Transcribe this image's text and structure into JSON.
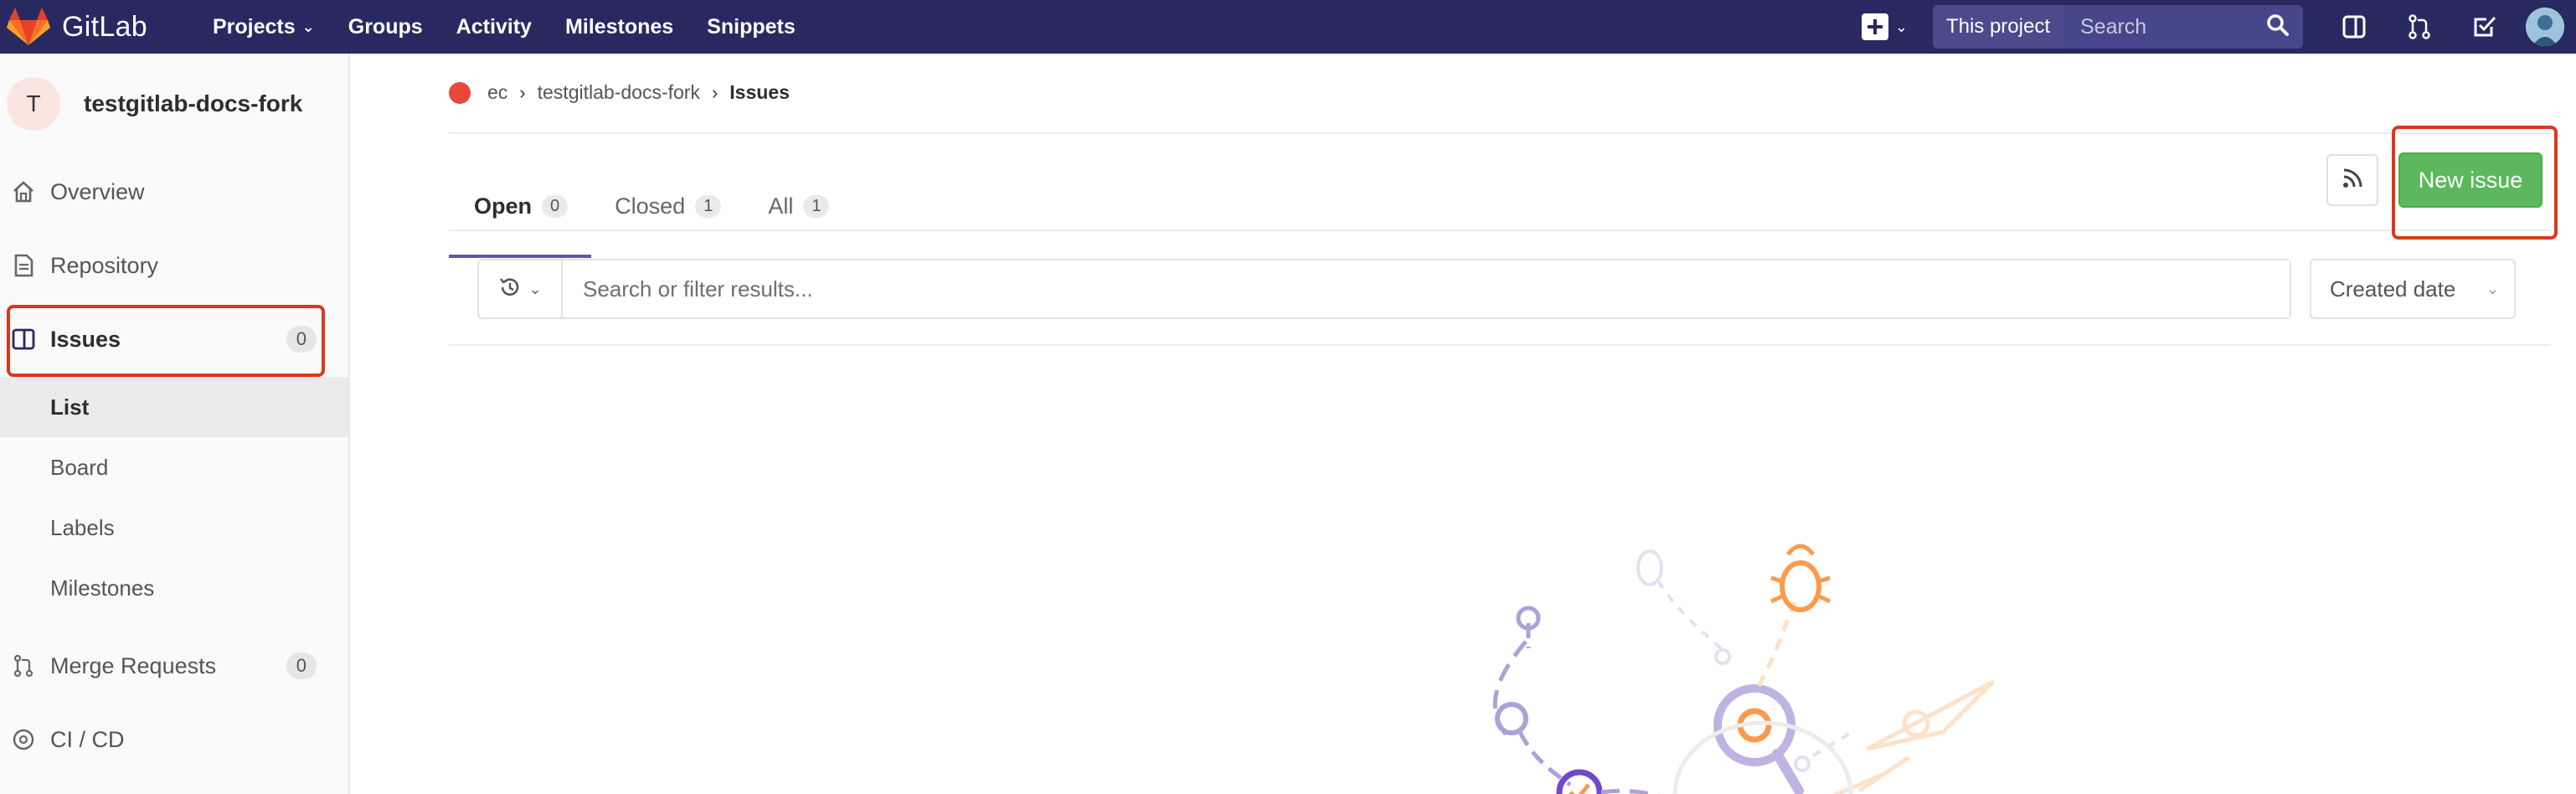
{
  "navbar": {
    "brand": "GitLab",
    "links": [
      {
        "label": "Projects",
        "has_caret": true
      },
      {
        "label": "Groups",
        "has_caret": false
      },
      {
        "label": "Activity",
        "has_caret": false
      },
      {
        "label": "Milestones",
        "has_caret": false
      },
      {
        "label": "Snippets",
        "has_caret": false
      }
    ],
    "search_scope": "This project",
    "search_placeholder": "Search",
    "icons": [
      "plus-icon",
      "sidebar-toggle-icon",
      "merge-request-icon",
      "todo-icon",
      "user-avatar"
    ]
  },
  "sidebar": {
    "project_initial": "T",
    "project_name": "testgitlab-docs-fork",
    "items": [
      {
        "label": "Overview",
        "icon": "home-icon"
      },
      {
        "label": "Repository",
        "icon": "document-icon"
      },
      {
        "label": "Issues",
        "icon": "issues-icon",
        "count": "0"
      },
      {
        "label": "Merge Requests",
        "icon": "merge-request-icon",
        "count": "0"
      },
      {
        "label": "CI / CD",
        "icon": "rocket-icon"
      }
    ],
    "issues_sub": [
      "List",
      "Board",
      "Labels",
      "Milestones"
    ]
  },
  "breadcrumb": {
    "group": "ec",
    "project": "testgitlab-docs-fork",
    "current": "Issues"
  },
  "tabs": [
    {
      "label": "Open",
      "count": "0"
    },
    {
      "label": "Closed",
      "count": "1"
    },
    {
      "label": "All",
      "count": "1"
    }
  ],
  "actions": {
    "new_issue": "New issue"
  },
  "filter": {
    "placeholder": "Search or filter results...",
    "sort_label": "Created date"
  },
  "colors": {
    "navbar": "#292961",
    "accent": "#6b4fbb",
    "new_issue_green": "#5cb85c",
    "highlight_red": "#d9381e"
  }
}
